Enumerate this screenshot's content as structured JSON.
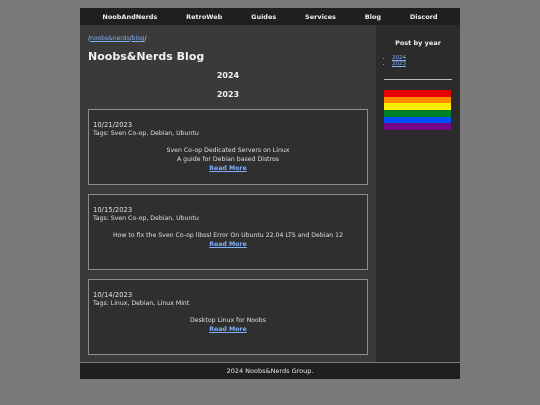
{
  "nav": {
    "items": [
      "NoobAndNerds",
      "RetroWeb",
      "Guides",
      "Services",
      "Blog",
      "Discord"
    ]
  },
  "breadcrumb": {
    "sep1": "/",
    "crumb1": "noobs&nerds",
    "sep2": "/",
    "crumb2": "blog",
    "sep3": "/"
  },
  "main": {
    "title": "Noobs&Nerds Blog",
    "years": [
      "2024",
      "2023"
    ],
    "posts": [
      {
        "date": "10/21/2023",
        "tags": "Tags: Sven Co-op, Debian, Ubuntu",
        "title": "Sven Co-op Dedicated Servers on Linux",
        "subtitle": "A guide for Debian based Distros",
        "read_more": "Read More"
      },
      {
        "date": "10/15/2023",
        "tags": "Tags: Sven Co-op, Debian, Ubuntu",
        "title": "How to fix the Sven Co-op libssl Error On Ubuntu 22.04 LTS and Debian 12",
        "read_more": "Read More"
      },
      {
        "date": "10/14/2023",
        "tags": "Tags: Linux, Debian, Linux Mint",
        "title": "Desktop Linux for Noobs",
        "read_more": "Read More"
      }
    ]
  },
  "sidebar": {
    "title": "Post by year",
    "years": [
      "2024",
      "2023"
    ],
    "flag_colors": [
      "#e40303",
      "#ff8c00",
      "#ffed00",
      "#008026",
      "#004dff",
      "#750787"
    ]
  },
  "footer": {
    "text": "2024 Noobs&Nerds Group."
  },
  "colors": {
    "background": "#7a7a7a",
    "nav_bg": "#1f1f1f",
    "main_bg": "#3a3a3a",
    "sidebar_bg": "#2b2b2b",
    "link": "#7fb0ff"
  }
}
